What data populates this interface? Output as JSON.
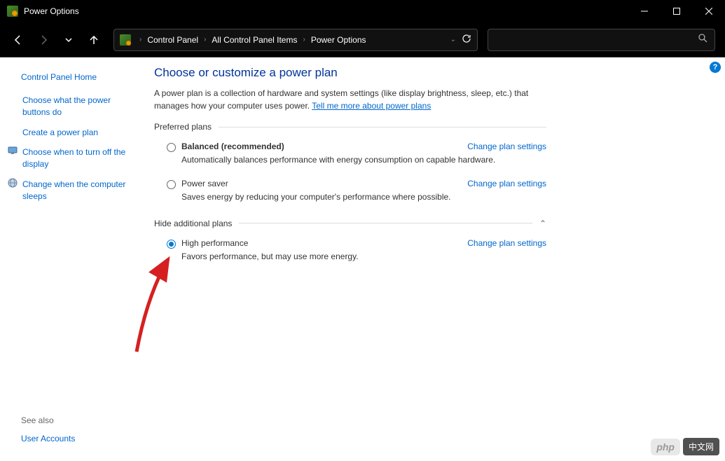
{
  "window": {
    "title": "Power Options"
  },
  "breadcrumbs": {
    "items": [
      "Control Panel",
      "All Control Panel Items",
      "Power Options"
    ]
  },
  "sidebar": {
    "home": "Control Panel Home",
    "links": [
      {
        "label": "Choose what the power buttons do",
        "icon": false
      },
      {
        "label": "Create a power plan",
        "icon": false
      },
      {
        "label": "Choose when to turn off the display",
        "icon": true,
        "icon_name": "display-icon"
      },
      {
        "label": "Change when the computer sleeps",
        "icon": true,
        "icon_name": "globe-icon"
      }
    ],
    "see_also_heading": "See also",
    "see_also": [
      "User Accounts"
    ]
  },
  "main": {
    "title": "Choose or customize a power plan",
    "description_1": "A power plan is a collection of hardware and system settings (like display brightness, sleep, etc.) that manages how your computer uses power. ",
    "tell_me_more": "Tell me more about power plans",
    "preferred_label": "Preferred plans",
    "hide_additional_label": "Hide additional plans",
    "change_label": "Change plan settings",
    "plans_preferred": [
      {
        "name": "Balanced (recommended)",
        "desc": "Automatically balances performance with energy consumption on capable hardware.",
        "bold": true,
        "selected": false
      },
      {
        "name": "Power saver",
        "desc": "Saves energy by reducing your computer's performance where possible.",
        "bold": false,
        "selected": false
      }
    ],
    "plans_additional": [
      {
        "name": "High performance",
        "desc": "Favors performance, but may use more energy.",
        "bold": false,
        "selected": true
      }
    ]
  },
  "watermark": {
    "badge": "php",
    "text": "中文网"
  }
}
